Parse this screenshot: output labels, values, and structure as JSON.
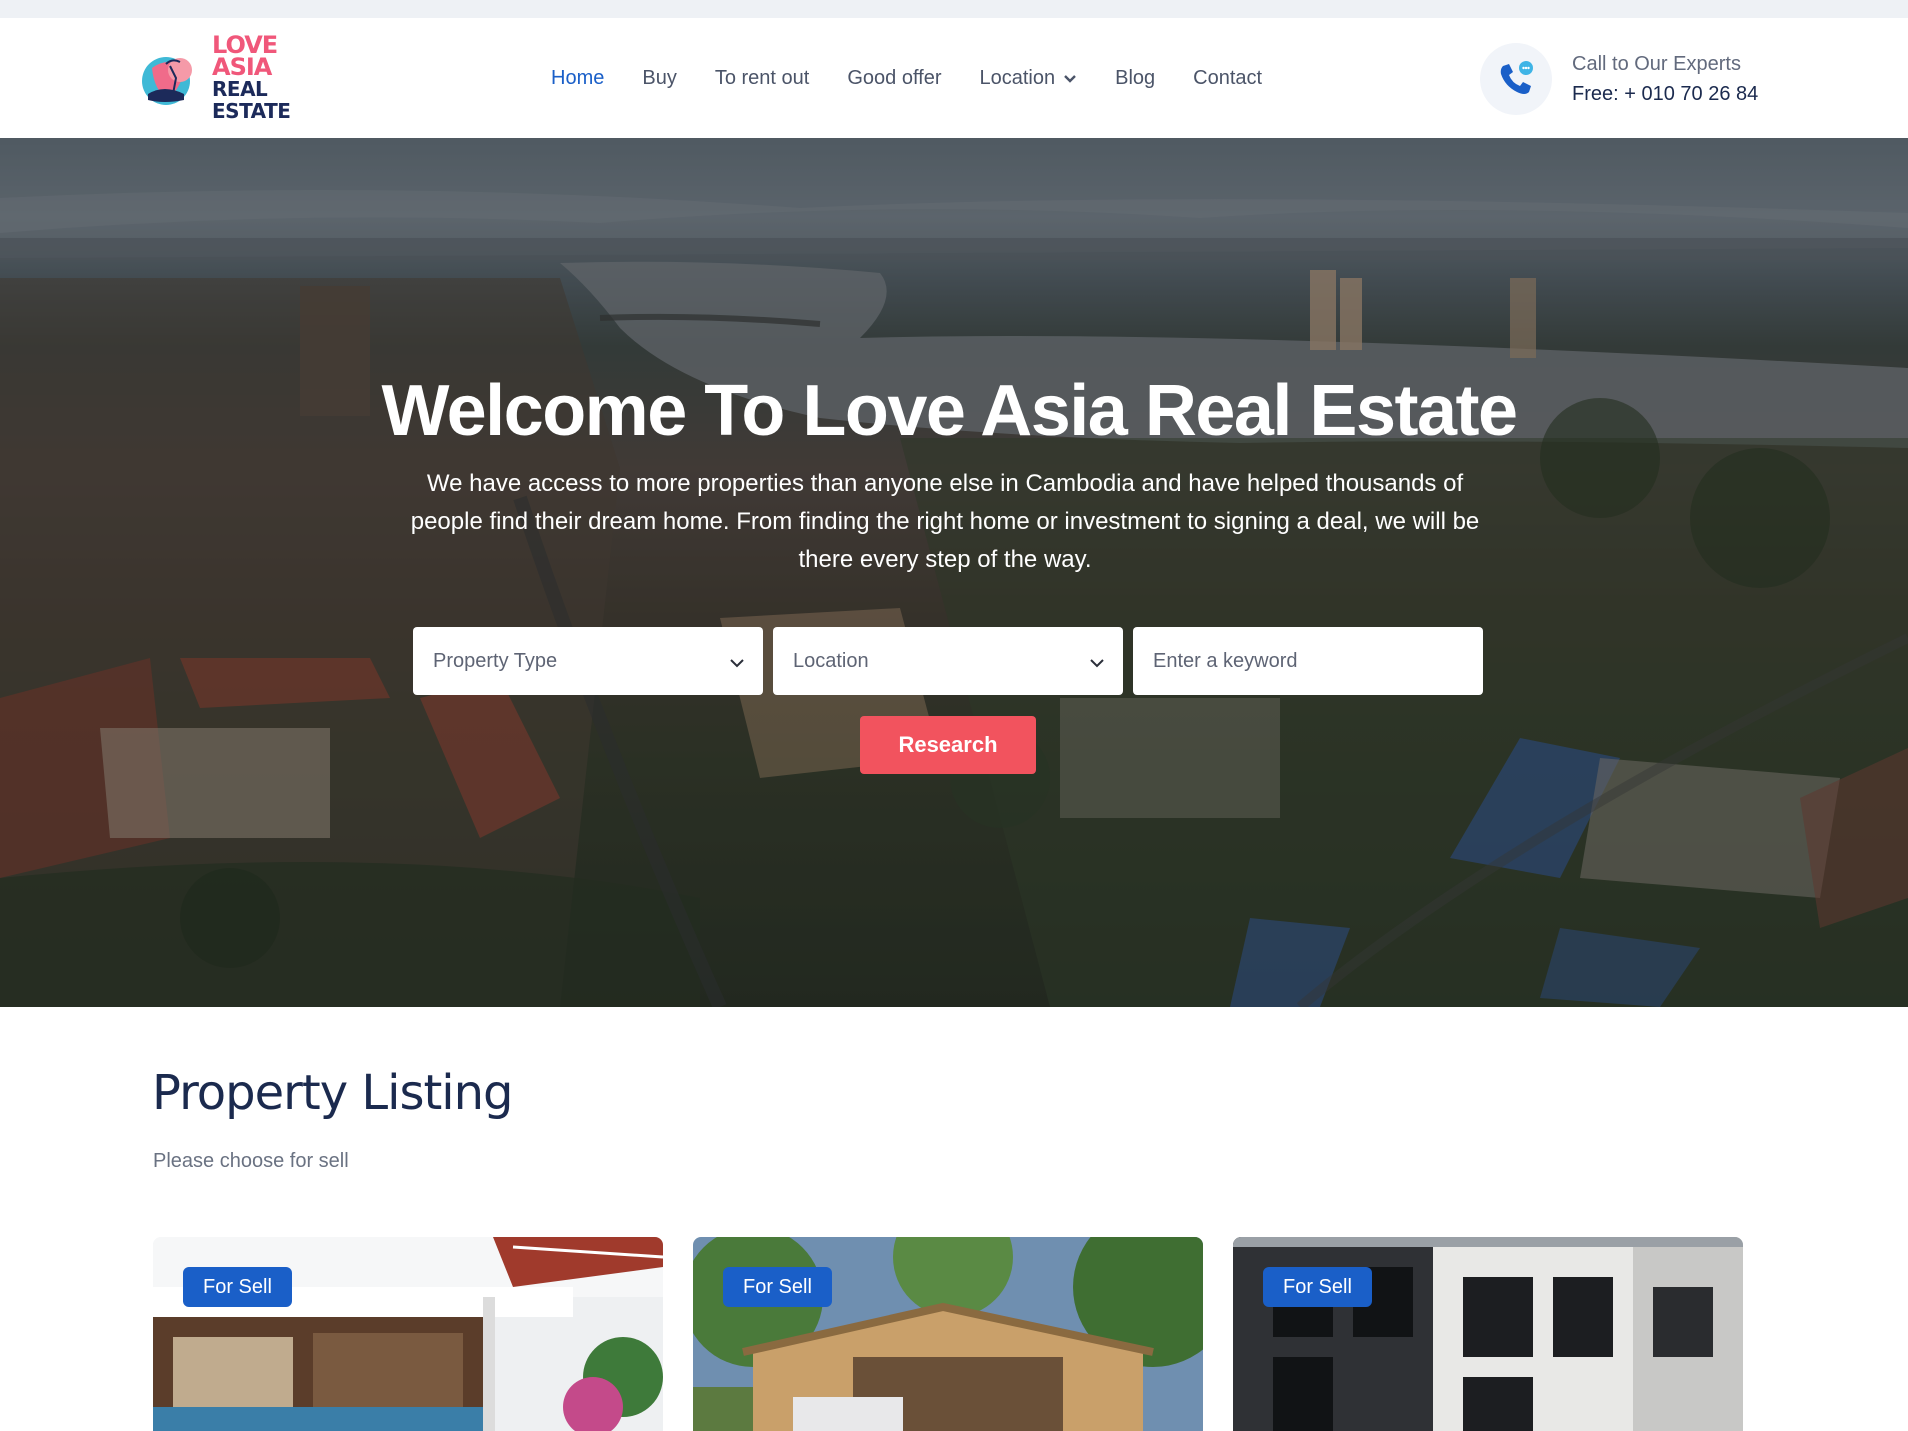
{
  "brand": {
    "line1": "LOVE ASIA",
    "line2": "REAL ESTATE",
    "colors": {
      "pink": "#f0577a",
      "navy": "#1c2a5a"
    }
  },
  "nav": {
    "items": [
      {
        "label": "Home",
        "active": true
      },
      {
        "label": "Buy"
      },
      {
        "label": "To rent out"
      },
      {
        "label": "Good offer"
      },
      {
        "label": "Location",
        "has_dropdown": true
      },
      {
        "label": "Blog"
      },
      {
        "label": "Contact"
      }
    ],
    "active_color": "#1a5fc8"
  },
  "contact": {
    "label": "Call to Our Experts",
    "phone": "Free: + 010 70 26 84",
    "icon": "phone-chat-icon"
  },
  "hero": {
    "title": "Welcome To Love Asia Real Estate",
    "subtitle": "We have access to more properties than anyone else in Cambodia and have helped thousands of people find their dream home. From finding the right home or investment to signing a deal, we will be there every step of the way."
  },
  "search": {
    "property_type": "Property Type",
    "location": "Location",
    "keyword_placeholder": "Enter a keyword",
    "button": "Research",
    "button_color": "#f2535e"
  },
  "listing": {
    "title": "Property Listing",
    "subtitle": "Please choose for sell",
    "cards": [
      {
        "badge": "For Sell"
      },
      {
        "badge": "For Sell"
      },
      {
        "badge": "For Sell"
      }
    ]
  }
}
